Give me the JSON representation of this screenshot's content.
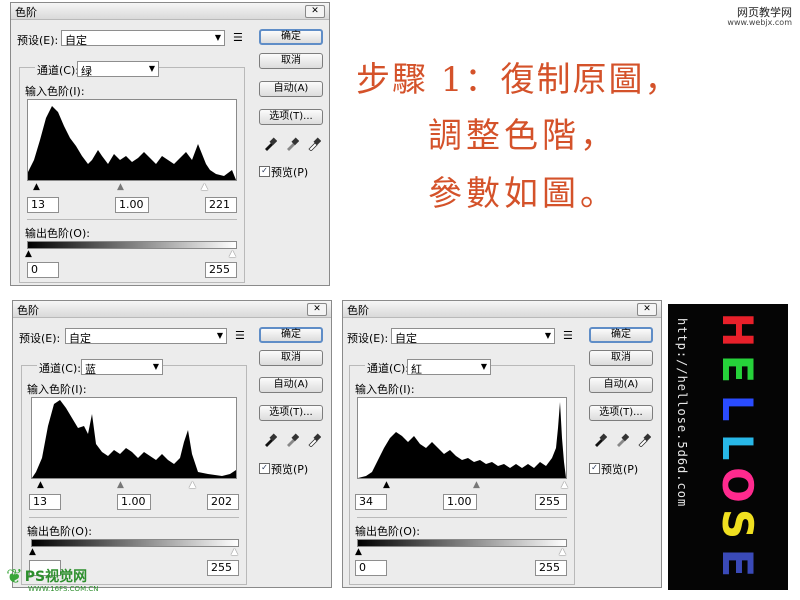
{
  "watermark": {
    "line1": "网页教学网",
    "line2": "www.webjx.com"
  },
  "dialog_a": {
    "title": "色阶",
    "preset_label": "预设(E):",
    "preset_value": "自定",
    "channel_label": "通道(C):",
    "channel_value": "绿",
    "input_levels_label": "输入色阶(I):",
    "output_levels_label": "输出色阶(O):",
    "input_black": "13",
    "input_gamma": "1.00",
    "input_white": "221",
    "output_black": "0",
    "output_white": "255",
    "btn_ok": "确定",
    "btn_cancel": "取消",
    "btn_auto": "自动(A)",
    "btn_options": "选项(T)...",
    "preview_label": "预览(P)"
  },
  "dialog_b": {
    "title": "色阶",
    "preset_label": "预设(E):",
    "preset_value": "自定",
    "channel_label": "通道(C):",
    "channel_value": "蓝",
    "input_levels_label": "输入色阶(I):",
    "output_levels_label": "输出色阶(O):",
    "input_black": "13",
    "input_gamma": "1.00",
    "input_white": "202",
    "output_black": "",
    "output_white": "255",
    "btn_ok": "确定",
    "btn_cancel": "取消",
    "btn_auto": "自动(A)",
    "btn_options": "选项(T)...",
    "preview_label": "预览(P)"
  },
  "dialog_c": {
    "title": "色阶",
    "preset_label": "预设(E):",
    "preset_value": "自定",
    "channel_label": "通道(C):",
    "channel_value": "紅",
    "input_levels_label": "输入色阶(I):",
    "output_levels_label": "输出色阶(O):",
    "input_black": "34",
    "input_gamma": "1.00",
    "input_white": "255",
    "output_black": "0",
    "output_white": "255",
    "btn_ok": "确定",
    "btn_cancel": "取消",
    "btn_auto": "自动(A)",
    "btn_options": "选项(T)...",
    "preview_label": "预览(P)"
  },
  "annotation": {
    "line1": "步驟 1：復制原圖，",
    "line2": "調整色階，",
    "line3": "參數如圖。"
  },
  "side_panel": {
    "url": "http://hellose.5d6d.com",
    "letters": [
      "H",
      "E",
      "L",
      "L",
      "O",
      "S",
      "E"
    ],
    "letter_colors": [
      "#e8202a",
      "#26d23a",
      "#2a4cff",
      "#28b8e8",
      "#ff2a8e",
      "#f0e020",
      "#3a4ab8"
    ]
  },
  "logo": {
    "brand": "PS视觉网",
    "site": "WWW.16FS.COM.CN"
  },
  "icons": {
    "close": "close-icon",
    "dropdown": "chevron-down-icon",
    "preset_menu": "list-menu-icon",
    "eyedropper_black": "eyedropper-black-icon",
    "eyedropper_gray": "eyedropper-gray-icon",
    "eyedropper_white": "eyedropper-white-icon",
    "checkbox": "checkmark-icon"
  },
  "colors": {
    "dialog_bg": "#ececec",
    "default_button_border": "#5f8dc7",
    "annotation_text": "#d4522a"
  }
}
